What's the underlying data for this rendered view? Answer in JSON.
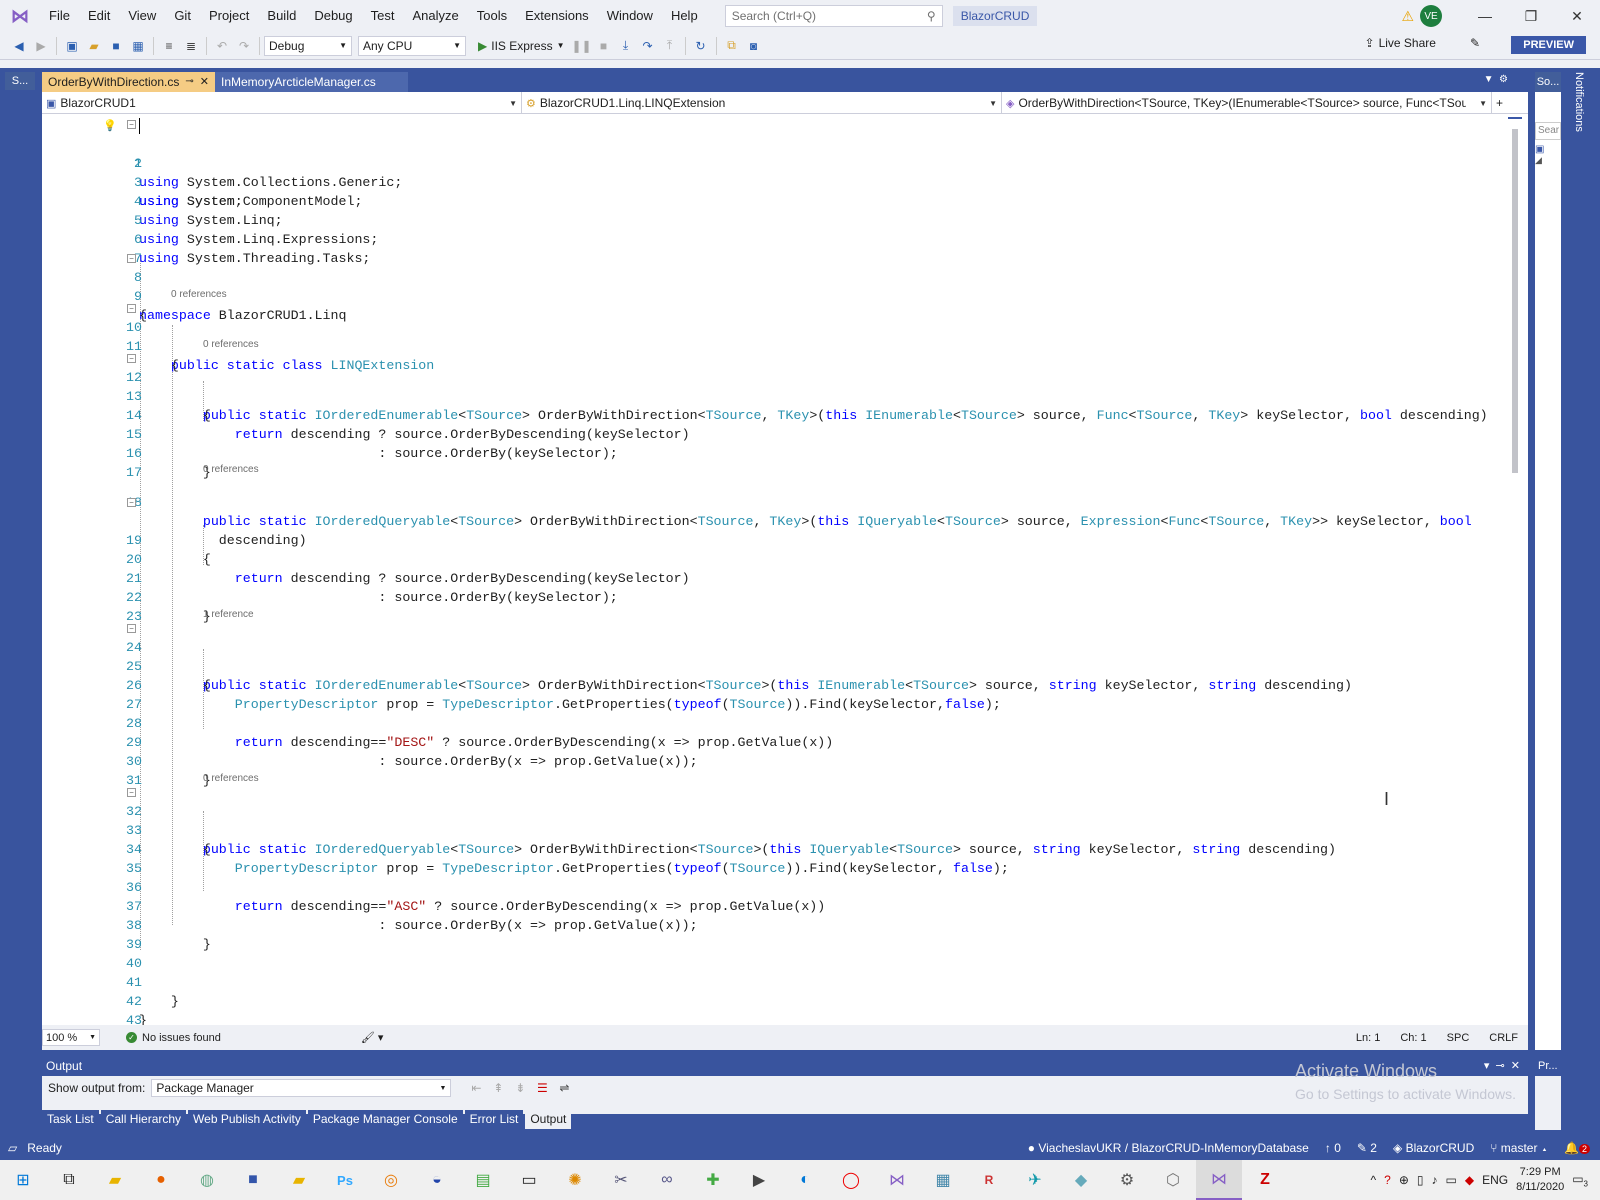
{
  "menubar": {
    "items": [
      "File",
      "Edit",
      "View",
      "Git",
      "Project",
      "Build",
      "Debug",
      "Test",
      "Analyze",
      "Tools",
      "Extensions",
      "Window",
      "Help"
    ],
    "search_placeholder": "Search (Ctrl+Q)",
    "solution_name": "BlazorCRUD",
    "user_initials": "VE"
  },
  "toolbar": {
    "config": "Debug",
    "platform": "Any CPU",
    "run_target": "IIS Express",
    "live_share": "Live Share",
    "preview": "PREVIEW"
  },
  "left_panel_tab": "S...",
  "right_panel_tab": "So...",
  "notifications_label": "Notifications",
  "right_search_placeholder": "Sear",
  "tabs": [
    {
      "label": "OrderByWithDirection.cs",
      "active": true
    },
    {
      "label": "InMemoryArcticleManager.cs",
      "active": false
    }
  ],
  "navbar": {
    "project": "BlazorCRUD1",
    "type": "BlazorCRUD1.Linq.LINQExtension",
    "member": "OrderByWithDirection<TSource, TKey>(IEnumerable<TSource> source, Func<TSource"
  },
  "code": {
    "line_numbers": [
      "1",
      "2",
      "3",
      "4",
      "5",
      "6",
      "7",
      "8",
      "9",
      "10",
      "11",
      "12",
      "13",
      "14",
      "15",
      "16",
      "17",
      "18",
      "19",
      "20",
      "21",
      "22",
      "23",
      "24",
      "25",
      "26",
      "27",
      "28",
      "29",
      "30",
      "31",
      "32",
      "33",
      "34",
      "35",
      "36",
      "37",
      "38",
      "39",
      "40",
      "41",
      "42",
      "43"
    ],
    "lenses": [
      "0 references",
      "0 references",
      "0 references",
      "1 reference",
      "0 references"
    ],
    "tokens": {
      "using": "using",
      "ns_system": " System;",
      "ns_collections": " System.Collections.Generic;",
      "ns_component": " System.ComponentModel;",
      "ns_linq": " System.Linq;",
      "ns_expressions": " System.Linq.Expressions;",
      "ns_tasks": " System.Threading.Tasks;",
      "namespace_kw": "namespace",
      "namespace_name": " BlazorCRUD1.Linq",
      "open_brace": "{",
      "close_brace": "}",
      "public_static_class": "public static class ",
      "class_name": "LINQExtension",
      "public_static": "public static ",
      "IOrderedEnumerable": "IOrderedEnumerable",
      "IOrderedQueryable": "IOrderedQueryable",
      "lt": "<",
      "gt": ">",
      "gt_gt": ">>",
      "TSource": "TSource",
      "TKey": "TKey",
      "method_name": "> OrderByWithDirection<",
      "comma_sp": ", ",
      "paren_this": ">(",
      "this_kw": "this ",
      "IEnumerable": "IEnumerable",
      "IQueryable": "IQueryable",
      "source": "> source, ",
      "Func": "Func",
      "Expression": "Expression",
      "keySelector": "> keySelector, ",
      "keySelector2": " keySelector, ",
      "bool_kw": "bool",
      "descending_close": " descending)",
      "descending_wrap": "descending)",
      "return_kw": "return",
      "return_cond": " descending ? source.OrderByDescending(keySelector)",
      "return_else": ": source.OrderBy(keySelector);",
      "string_kw": "string",
      "method_name_single": "> OrderByWithDirection<",
      "PropertyDescriptor": "PropertyDescriptor",
      "prop_assign": " prop = ",
      "TypeDescriptor": "TypeDescriptor",
      "get_props": ".GetProperties(",
      "typeof_kw": "typeof",
      "find_open": ")).Find(keySelector,",
      "find_open2": ")).Find(keySelector, ",
      "false_kw": "false",
      "close_paren_semi": ");",
      "desc_eq": " descending==",
      "str_desc": "\"DESC\"",
      "str_asc": "\"ASC\"",
      "order_desc_x": " ? source.OrderByDescending(x => prop.GetValue(x))",
      "order_x": ": source.OrderBy(x => prop.GetValue(x));",
      "paren_open": "(",
      "paren_close": ")"
    }
  },
  "editor_status": {
    "zoom": "100 %",
    "issues": "No issues found",
    "ln": "Ln: 1",
    "ch": "Ch: 1",
    "spc": "SPC",
    "crlf": "CRLF"
  },
  "output": {
    "title": "Output",
    "show_from_label": "Show output from:",
    "source": "Package Manager",
    "activate_title": "Activate Windows",
    "activate_sub": "Go to Settings to activate Windows.",
    "right_tab": "Pr..."
  },
  "bottom_tabs": [
    "Task List",
    "Call Hierarchy",
    "Web Publish Activity",
    "Package Manager Console",
    "Error List",
    "Output"
  ],
  "statusbar": {
    "ready": "Ready",
    "repo": "ViacheslavUKR / BlazorCRUD-InMemoryDatabase",
    "push_count": "0",
    "changes_count": "2",
    "solution": "BlazorCRUD",
    "branch": "master",
    "notif_count": "2"
  },
  "taskbar": {
    "lang": "ENG",
    "time": "7:29 PM",
    "date": "8/11/2020",
    "notif_badge": "3"
  }
}
